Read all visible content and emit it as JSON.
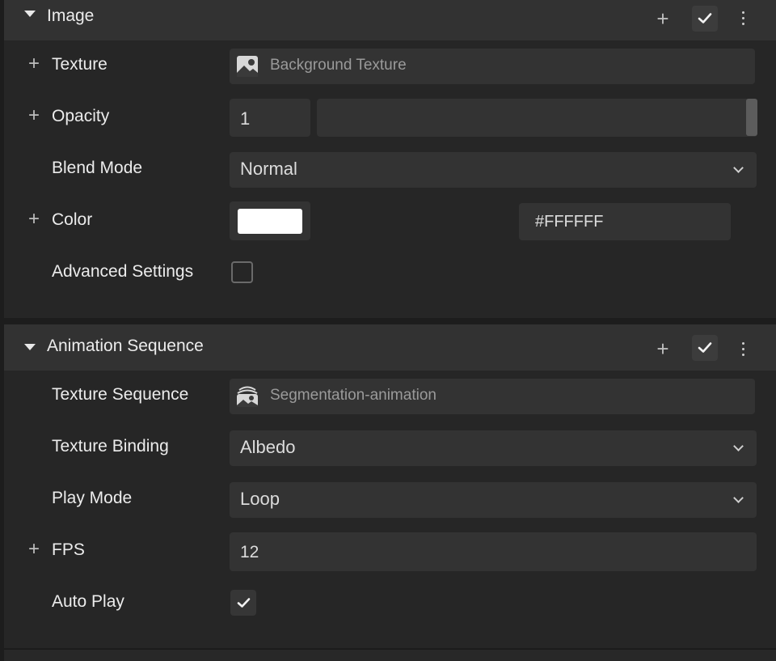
{
  "image_panel": {
    "title": "Image",
    "texture": {
      "label": "Texture",
      "value": "Background Texture"
    },
    "opacity": {
      "label": "Opacity",
      "value": "1"
    },
    "blend_mode": {
      "label": "Blend Mode",
      "value": "Normal"
    },
    "color": {
      "label": "Color",
      "hex": "#FFFFFF",
      "swatch": "#ffffff"
    },
    "advanced": {
      "label": "Advanced Settings",
      "checked": false
    }
  },
  "animation_panel": {
    "title": "Animation Sequence",
    "texture_sequence": {
      "label": "Texture Sequence",
      "value": "Segmentation-animation"
    },
    "texture_binding": {
      "label": "Texture Binding",
      "value": "Albedo"
    },
    "play_mode": {
      "label": "Play Mode",
      "value": "Loop"
    },
    "fps": {
      "label": "FPS",
      "value": "12"
    },
    "auto_play": {
      "label": "Auto Play",
      "checked": true
    }
  },
  "icons": {
    "add": "+",
    "enabled": "check-icon",
    "menu": "kebab-menu-icon",
    "collapse": "caret-down-icon"
  }
}
